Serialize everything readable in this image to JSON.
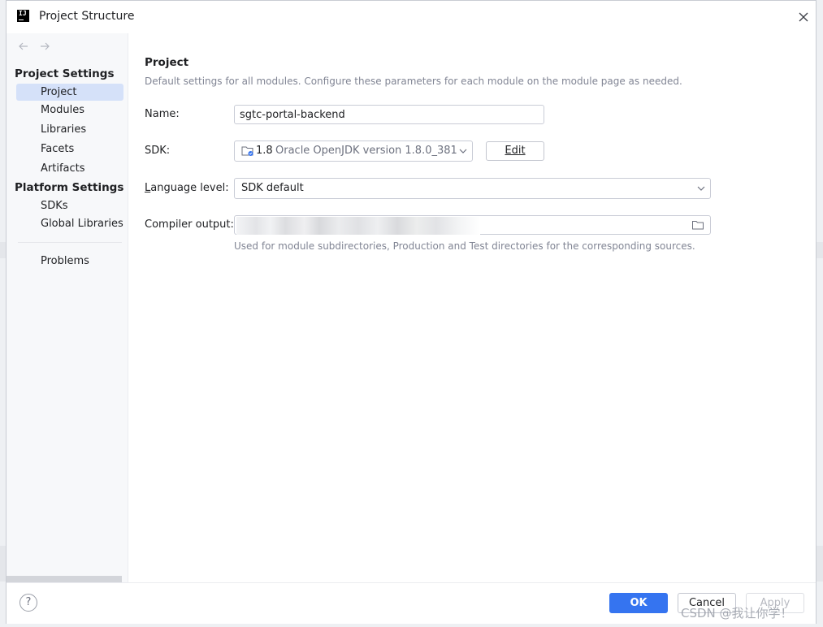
{
  "window": {
    "title": "Project Structure"
  },
  "sidebar": {
    "project_settings_header": "Project Settings",
    "project_items": [
      {
        "label": "Project",
        "selected": true
      },
      {
        "label": "Modules",
        "selected": false
      },
      {
        "label": "Libraries",
        "selected": false
      },
      {
        "label": "Facets",
        "selected": false
      },
      {
        "label": "Artifacts",
        "selected": false
      }
    ],
    "platform_settings_header": "Platform Settings",
    "platform_items": [
      {
        "label": "SDKs"
      },
      {
        "label": "Global Libraries"
      }
    ],
    "problems_label": "Problems"
  },
  "main": {
    "title": "Project",
    "description": "Default settings for all modules. Configure these parameters for each module on the module page as needed.",
    "name_label": "Name:",
    "name_value": "sgtc-portal-backend",
    "sdk_label": "SDK:",
    "sdk_version": "1.8",
    "sdk_description": "Oracle OpenJDK version 1.8.0_381",
    "edit_button": "Edit",
    "language_level_label_underlined": "L",
    "language_level_label_rest": "anguage level:",
    "language_level_value": "SDK default",
    "compiler_output_label": "Compiler output:",
    "compiler_output_hint": "Used for module subdirectories, Production and Test directories for the corresponding sources."
  },
  "footer": {
    "help_label": "?",
    "ok_label": "OK",
    "cancel_label": "Cancel",
    "apply_label": "Apply"
  },
  "watermark": "CSDN @我让你学！",
  "colors": {
    "accent": "#3574f0",
    "selection": "#d5e1f9",
    "hint_text": "#818594"
  }
}
